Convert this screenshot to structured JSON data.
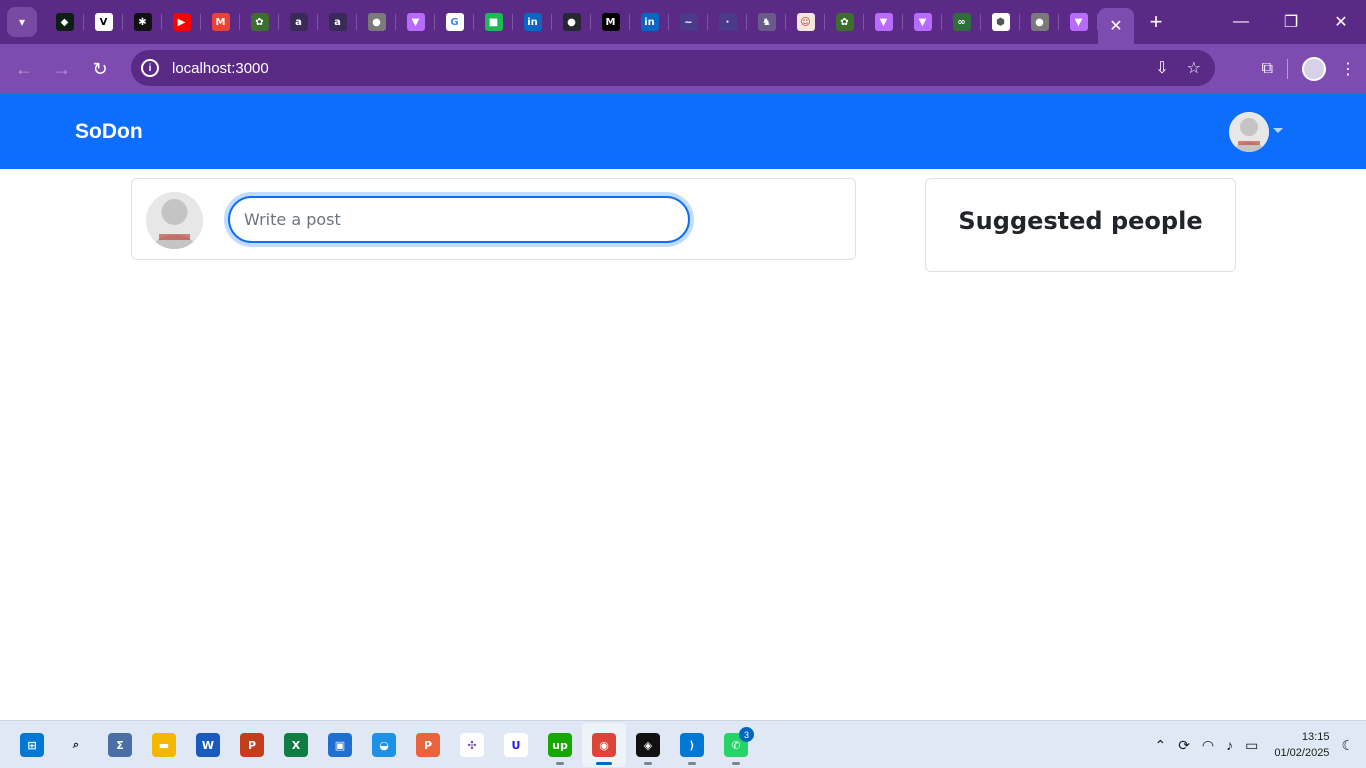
{
  "browser": {
    "tab_icons": [
      {
        "name": "tab-favicon-1",
        "color": "#0b1f14",
        "glyph": "◆"
      },
      {
        "name": "tab-favicon-2",
        "color": "#ffffff",
        "glyph": "V",
        "fg": "#000"
      },
      {
        "name": "tab-favicon-3",
        "color": "#111111",
        "glyph": "✱"
      },
      {
        "name": "tab-favicon-youtube",
        "color": "#ff0000",
        "glyph": "▶"
      },
      {
        "name": "tab-favicon-gmail",
        "color": "#ea4335",
        "glyph": "M"
      },
      {
        "name": "tab-favicon-6",
        "color": "#3c6e2f",
        "glyph": "✿"
      },
      {
        "name": "tab-favicon-alx-1",
        "color": "#3a2a5a",
        "glyph": "a"
      },
      {
        "name": "tab-favicon-alx-2",
        "color": "#3a2a5a",
        "glyph": "a"
      },
      {
        "name": "tab-favicon-globe-1",
        "color": "#7a7a7a",
        "glyph": "●"
      },
      {
        "name": "tab-favicon-vite-1",
        "color": "#b86cff",
        "glyph": "▼"
      },
      {
        "name": "tab-favicon-google",
        "color": "#ffffff",
        "glyph": "G",
        "fg": "#4285f4"
      },
      {
        "name": "tab-favicon-green",
        "color": "#1db954",
        "glyph": "■"
      },
      {
        "name": "tab-favicon-linkedin-1",
        "color": "#0a66c2",
        "glyph": "in"
      },
      {
        "name": "tab-favicon-github",
        "color": "#24292f",
        "glyph": "●"
      },
      {
        "name": "tab-favicon-medium",
        "color": "#000000",
        "glyph": "M"
      },
      {
        "name": "tab-favicon-linkedin-2",
        "color": "#0a66c2",
        "glyph": "in"
      },
      {
        "name": "tab-favicon-17",
        "color": "#4b3a8a",
        "glyph": "~"
      },
      {
        "name": "tab-favicon-18",
        "color": "#4b3a8a",
        "glyph": "·"
      },
      {
        "name": "tab-favicon-19",
        "color": "#6a5a8a",
        "glyph": "♞"
      },
      {
        "name": "tab-favicon-20",
        "color": "#f3e6dc",
        "glyph": "☺",
        "fg": "#c0392b"
      },
      {
        "name": "tab-favicon-21",
        "color": "#3c6e2f",
        "glyph": "✿"
      },
      {
        "name": "tab-favicon-vite-2",
        "color": "#b86cff",
        "glyph": "▼"
      },
      {
        "name": "tab-favicon-vite-3",
        "color": "#b86cff",
        "glyph": "▼"
      },
      {
        "name": "tab-favicon-24",
        "color": "#2f6d3a",
        "glyph": "∞"
      },
      {
        "name": "tab-favicon-25",
        "color": "#ffffff",
        "glyph": "⬢",
        "fg": "#555"
      },
      {
        "name": "tab-favicon-globe-2",
        "color": "#7a7a7a",
        "glyph": "●"
      },
      {
        "name": "tab-favicon-vite-4",
        "color": "#b86cff",
        "glyph": "▼"
      }
    ],
    "url": "localhost:3000"
  },
  "app": {
    "brand": "SoDon",
    "post_placeholder": "Write a post",
    "suggested_title": "Suggested people"
  },
  "taskbar": {
    "apps": [
      {
        "name": "start-icon",
        "color": "#0078d4",
        "glyph": "⊞",
        "active": false,
        "running": false
      },
      {
        "name": "search-icon",
        "color": "transparent",
        "glyph": "⌕",
        "fg": "#1b1b1b",
        "active": false,
        "running": false
      },
      {
        "name": "app-calculator-icon",
        "color": "#4a6fa5",
        "glyph": "Σ",
        "active": false,
        "running": false
      },
      {
        "name": "file-explorer-icon",
        "color": "#f2b700",
        "glyph": "▬",
        "active": false,
        "running": false
      },
      {
        "name": "word-icon",
        "color": "#185abd",
        "glyph": "W",
        "active": false,
        "running": false
      },
      {
        "name": "powerpoint-icon",
        "color": "#c43e1c",
        "glyph": "P",
        "active": false,
        "running": false
      },
      {
        "name": "excel-icon",
        "color": "#107c41",
        "glyph": "X",
        "active": false,
        "running": false
      },
      {
        "name": "app-blue-icon",
        "color": "#1f6fd1",
        "glyph": "▣",
        "active": false,
        "running": false
      },
      {
        "name": "docker-icon",
        "color": "#1d91e6",
        "glyph": "◒",
        "active": false,
        "running": false
      },
      {
        "name": "app-orange-icon",
        "color": "#e8643c",
        "glyph": "P",
        "active": false,
        "running": false
      },
      {
        "name": "app-graph-icon",
        "color": "#ffffff",
        "glyph": "✣",
        "fg": "#7a4fb0",
        "active": false,
        "running": false
      },
      {
        "name": "udacity-icon",
        "color": "#ffffff",
        "glyph": "U",
        "fg": "#2015ff",
        "active": false,
        "running": false
      },
      {
        "name": "upwork-icon",
        "color": "#14a800",
        "glyph": "up",
        "active": false,
        "running": true
      },
      {
        "name": "chrome-icon",
        "color": "#db4437",
        "glyph": "◉",
        "active": true,
        "running": true
      },
      {
        "name": "app-black-icon",
        "color": "#111111",
        "glyph": "◈",
        "active": false,
        "running": true
      },
      {
        "name": "vscode-icon",
        "color": "#0078d4",
        "glyph": "⟩",
        "active": false,
        "running": true
      },
      {
        "name": "whatsapp-icon",
        "color": "#25d366",
        "glyph": "✆",
        "active": false,
        "running": true,
        "badge": "3"
      }
    ],
    "time": "13:15",
    "date": "01/02/2025"
  }
}
